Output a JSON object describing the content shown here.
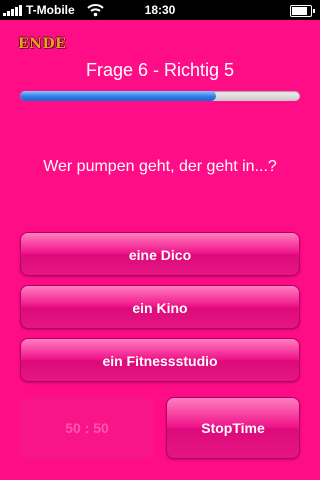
{
  "status_bar": {
    "carrier": "T-Mobile",
    "time": "18:30",
    "battery_level": 0.85
  },
  "header": {
    "end_label": "ENDE",
    "title": "Frage 6 - Richtig 5",
    "progress": 0.7
  },
  "question": "Wer pumpen geht, der geht in...?",
  "answers": [
    "eine Dico",
    "ein Kino",
    "ein Fitnessstudio"
  ],
  "jokers": {
    "fifty_fifty": "50 : 50",
    "stop_time": "StopTime"
  },
  "colors": {
    "background": "#ff0d87",
    "progress_fill": "#2f7ee8",
    "end_label": "#e8a21a"
  }
}
